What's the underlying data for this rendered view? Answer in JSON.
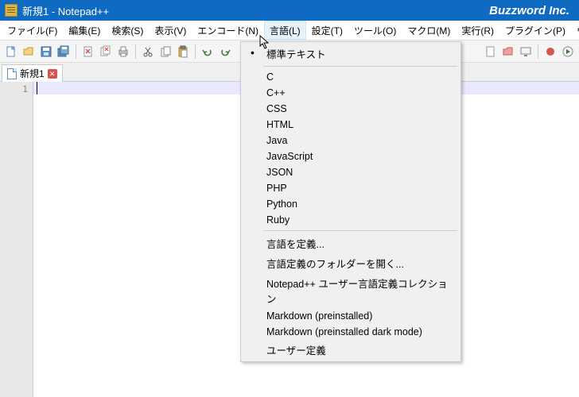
{
  "titlebar": {
    "title": "新規1 - Notepad++",
    "brand": "Buzzword Inc."
  },
  "menubar": {
    "items": [
      {
        "label": "ファイル(F)"
      },
      {
        "label": "編集(E)"
      },
      {
        "label": "検索(S)"
      },
      {
        "label": "表示(V)"
      },
      {
        "label": "エンコード(N)"
      },
      {
        "label": "言語(L)",
        "open": true
      },
      {
        "label": "設定(T)"
      },
      {
        "label": "ツール(O)"
      },
      {
        "label": "マクロ(M)"
      },
      {
        "label": "実行(R)"
      },
      {
        "label": "プラグイン(P)"
      },
      {
        "label": "ウィンドウ管理(W)"
      }
    ]
  },
  "tabs": {
    "active": {
      "label": "新規1"
    }
  },
  "gutter": {
    "line1": "1"
  },
  "dropdown": {
    "items": [
      {
        "label": "標準テキスト",
        "selected": true
      },
      {
        "sep": true
      },
      {
        "label": "C"
      },
      {
        "label": "C++"
      },
      {
        "label": "CSS"
      },
      {
        "label": "HTML"
      },
      {
        "label": "Java"
      },
      {
        "label": "JavaScript"
      },
      {
        "label": "JSON"
      },
      {
        "label": "PHP"
      },
      {
        "label": "Python"
      },
      {
        "label": "Ruby"
      },
      {
        "sep": true
      },
      {
        "label": "言語を定義..."
      },
      {
        "label": "言語定義のフォルダーを開く..."
      },
      {
        "label": "Notepad++ ユーザー言語定義コレクション"
      },
      {
        "label": "Markdown (preinstalled)"
      },
      {
        "label": "Markdown (preinstalled dark mode)"
      },
      {
        "label": "ユーザー定義"
      }
    ]
  },
  "colors": {
    "titlebar_bg": "#0f6ac2",
    "accent": "#e5f1fb"
  }
}
